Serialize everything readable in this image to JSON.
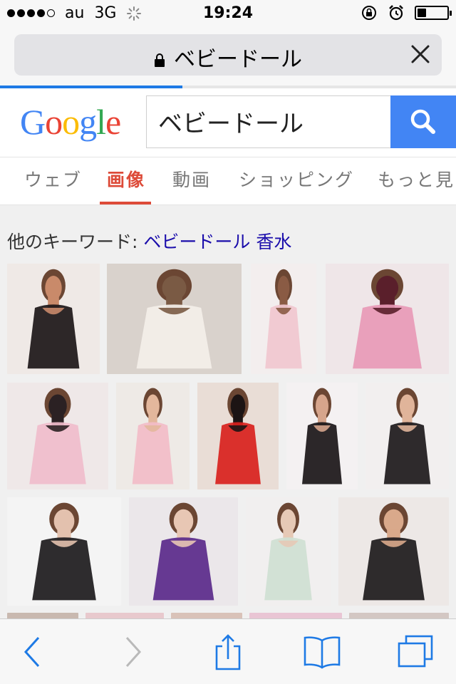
{
  "status": {
    "carrier": "au",
    "network": "3G",
    "time": "19:24",
    "signal_bars_filled": 4,
    "signal_bars_total": 5,
    "battery_level": 0.3
  },
  "urlbar": {
    "text": "ベビードール",
    "secure": true,
    "page_load_progress": 0.4
  },
  "google": {
    "logo": {
      "letters": [
        "G",
        "o",
        "o",
        "g",
        "l",
        "e"
      ],
      "colors": [
        "#4285f4",
        "#ea4335",
        "#fbbc05",
        "#4285f4",
        "#34a853",
        "#ea4335"
      ]
    },
    "query": "ベビードール"
  },
  "tabs": [
    {
      "label": "ウェブ",
      "active": false
    },
    {
      "label": "画像",
      "active": true
    },
    {
      "label": "動画",
      "active": false
    },
    {
      "label": "ショッピング",
      "active": false
    },
    {
      "label": "もっと見る",
      "active": false
    }
  ],
  "related": {
    "prefix": "他のキーワード: ",
    "link": "ベビードール 香水"
  },
  "image_results": [
    {
      "desc": "woman in black babydoll",
      "colors": [
        "#efe9e6",
        "#1c1618",
        "#c98a6a"
      ]
    },
    {
      "desc": "woman in white lace babydoll",
      "colors": [
        "#d9d2cc",
        "#f4efe9",
        "#7a5a44"
      ]
    },
    {
      "desc": "woman in pink babydoll",
      "colors": [
        "#f3eeee",
        "#f1c7cf",
        "#8a5b44"
      ]
    },
    {
      "desc": "M-3L size pink babydoll set",
      "colors": [
        "#efe6e8",
        "#e89ab6",
        "#5a1f2b"
      ]
    },
    {
      "desc": "pink and black babydoll set",
      "colors": [
        "#efe8e8",
        "#f0bccb",
        "#2b2123"
      ]
    },
    {
      "desc": "woman in pink ribbon lingerie",
      "colors": [
        "#eeeae6",
        "#f2bcc8",
        "#e3b79c"
      ]
    },
    {
      "desc": "woman in red babydoll",
      "colors": [
        "#e9ddd6",
        "#d8211d",
        "#1c1414"
      ]
    },
    {
      "desc": "woman in black ruffle babydoll",
      "colors": [
        "#f4f1f2",
        "#1a1618",
        "#d6a58c"
      ]
    },
    {
      "desc": "woman in black lace teddy",
      "colors": [
        "#f2efef",
        "#1d191b",
        "#e0b49a"
      ]
    },
    {
      "desc": "woman in black sheer babydoll",
      "colors": [
        "#f4f4f4",
        "#1c1a1c",
        "#e3c1ae"
      ]
    },
    {
      "desc": "woman in purple babydoll",
      "colors": [
        "#ebe7ea",
        "#5a2a8a",
        "#e8c7b4"
      ]
    },
    {
      "desc": "woman in mint lace lingerie",
      "colors": [
        "#f1efef",
        "#cfe0d3",
        "#e6c9b6"
      ]
    },
    {
      "desc": "woman in black satin babydoll",
      "colors": [
        "#ede8e6",
        "#1d1a1c",
        "#d9a98b"
      ]
    }
  ],
  "toolbar": {
    "buttons": [
      "back",
      "forward",
      "share",
      "bookmarks",
      "tabs"
    ]
  }
}
